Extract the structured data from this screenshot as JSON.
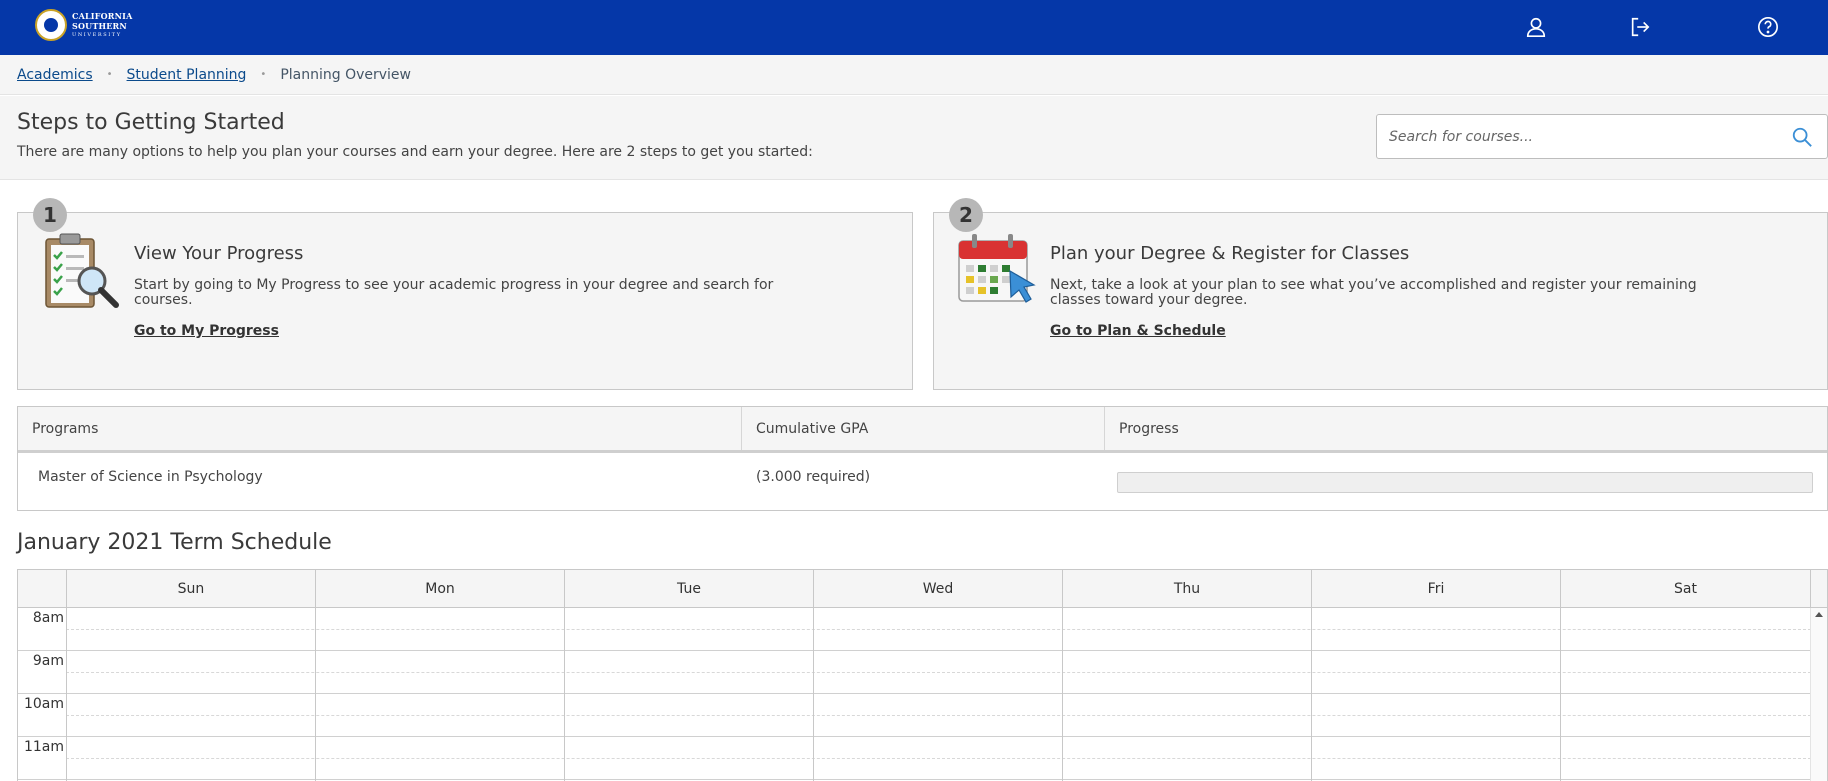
{
  "header": {
    "logo": {
      "line1": "CALIFORNIA",
      "line2": "SOUTHERN",
      "line3": "UNIVERSITY"
    },
    "icons": [
      "user-icon",
      "sign-out-icon",
      "help-icon"
    ]
  },
  "breadcrumb": {
    "items": [
      "Academics",
      "Student Planning"
    ],
    "current": "Planning Overview",
    "separator": "•"
  },
  "steps": {
    "title": "Steps to Getting Started",
    "subtitle": "There are many options to help you plan your courses and earn your degree. Here are 2 steps to get you started:",
    "search_placeholder": "Search for courses...",
    "cards": [
      {
        "number": "1",
        "title": "View Your Progress",
        "description": "Start by going to My Progress to see your academic progress in your degree and search for courses.",
        "link": "Go to My Progress",
        "icon": "clipboard-magnifier-icon"
      },
      {
        "number": "2",
        "title": "Plan your Degree & Register for Classes",
        "description": "Next, take a look at your plan to see what you’ve accomplished and register your remaining classes toward your degree.",
        "link": "Go to Plan & Schedule",
        "icon": "calendar-cursor-icon"
      }
    ]
  },
  "programs": {
    "columns": [
      "Programs",
      "Cumulative GPA",
      "Progress"
    ],
    "rows": [
      {
        "program": "Master of Science in Psychology",
        "gpa": "(3.000 required)",
        "progress": 0
      }
    ]
  },
  "schedule": {
    "title": "January 2021 Term Schedule",
    "days": [
      "Sun",
      "Mon",
      "Tue",
      "Wed",
      "Thu",
      "Fri",
      "Sat"
    ],
    "hours": [
      "8am",
      "9am",
      "10am",
      "11am"
    ]
  },
  "colors": {
    "header_bg": "#0537a8",
    "link": "#0b4a8b",
    "panel_bg": "#f5f5f5"
  }
}
